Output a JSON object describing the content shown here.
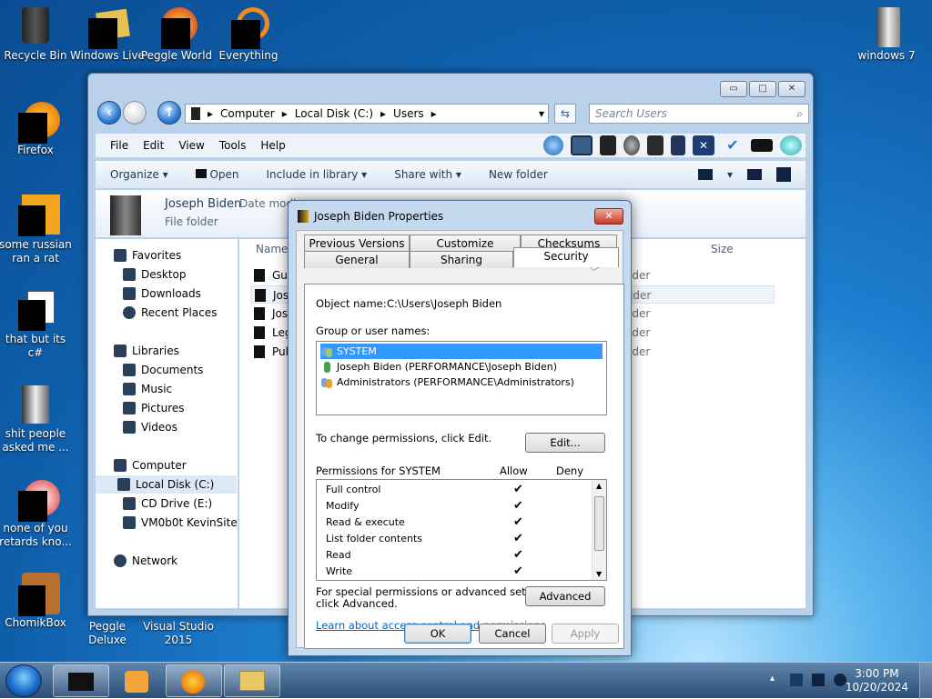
{
  "desktop": {
    "icons": [
      {
        "label": "Recycle Bin"
      },
      {
        "label": "Windows Live Mail"
      },
      {
        "label": "Peggle World of Warcraft"
      },
      {
        "label": "Everything"
      },
      {
        "label": "windows 7"
      },
      {
        "label": "Firefox"
      },
      {
        "label": "some russian ran a rat"
      },
      {
        "label": "that but its c#"
      },
      {
        "label": "shit people asked me ..."
      },
      {
        "label": "none of you retards kno..."
      },
      {
        "label": "ChomikBox"
      },
      {
        "label": "Peggle Deluxe"
      },
      {
        "label": "Visual Studio 2015"
      }
    ]
  },
  "explorer": {
    "breadcrumb": [
      "Computer",
      "Local Disk (C:)",
      "Users"
    ],
    "search_placeholder": "Search Users",
    "menu": [
      "File",
      "Edit",
      "View",
      "Tools",
      "Help"
    ],
    "commands": {
      "organize": "Organize",
      "open": "Open",
      "include": "Include in library",
      "share": "Share with",
      "new_folder": "New folder"
    },
    "details": {
      "name": "Joseph Biden",
      "type": "File folder",
      "date_label": "Date modi"
    },
    "nav": {
      "favorites": "Favorites",
      "desktop": "Desktop",
      "downloads": "Downloads",
      "recent": "Recent Places",
      "libraries": "Libraries",
      "documents": "Documents",
      "music": "Music",
      "pictures": "Pictures",
      "videos": "Videos",
      "computer": "Computer",
      "local_disk": "Local Disk (C:)",
      "cd_drive": "CD Drive (E:)",
      "vm": "VM0b0t KevinSite",
      "network": "Network"
    },
    "columns": {
      "name": "Name",
      "size": "Size"
    },
    "files": [
      {
        "name": "Gu",
        "type": "lder"
      },
      {
        "name": "Jos",
        "type": "lder"
      },
      {
        "name": "Jos",
        "type": "lder"
      },
      {
        "name": "Leg",
        "type": "lder"
      },
      {
        "name": "Pul",
        "type": "lder"
      }
    ]
  },
  "props": {
    "title": "Joseph Biden Properties",
    "tabs_row1": [
      "Previous Versions",
      "Customize",
      "Checksums"
    ],
    "tabs_row2": [
      "General",
      "Sharing",
      "Security"
    ],
    "object_label": "Object name:",
    "object_value": "C:\\Users\\Joseph Biden",
    "group_label": "Group or user names:",
    "users": [
      "SYSTEM",
      "Joseph Biden (PERFORMANCE\\Joseph Biden)",
      "Administrators (PERFORMANCE\\Administrators)"
    ],
    "change_text": "To change permissions, click Edit.",
    "edit_btn": "Edit...",
    "perm_header": "Permissions for SYSTEM",
    "allow": "Allow",
    "deny": "Deny",
    "permissions": [
      {
        "name": "Full control",
        "mark": "✔"
      },
      {
        "name": "Modify",
        "mark": "✔"
      },
      {
        "name": "Read & execute",
        "mark": "✔"
      },
      {
        "name": "List folder contents",
        "mark": "✔"
      },
      {
        "name": "Read",
        "mark": "✔"
      },
      {
        "name": "Write",
        "mark": "✔"
      }
    ],
    "special_line1": "For special permissions or advanced settings,",
    "special_line2": "click Advanced.",
    "advanced_btn": "Advanced",
    "link": "Learn about access control and permissions",
    "ok": "OK",
    "cancel": "Cancel",
    "apply": "Apply"
  },
  "taskbar": {
    "time": "3:00 PM",
    "date": "10/20/2024"
  }
}
